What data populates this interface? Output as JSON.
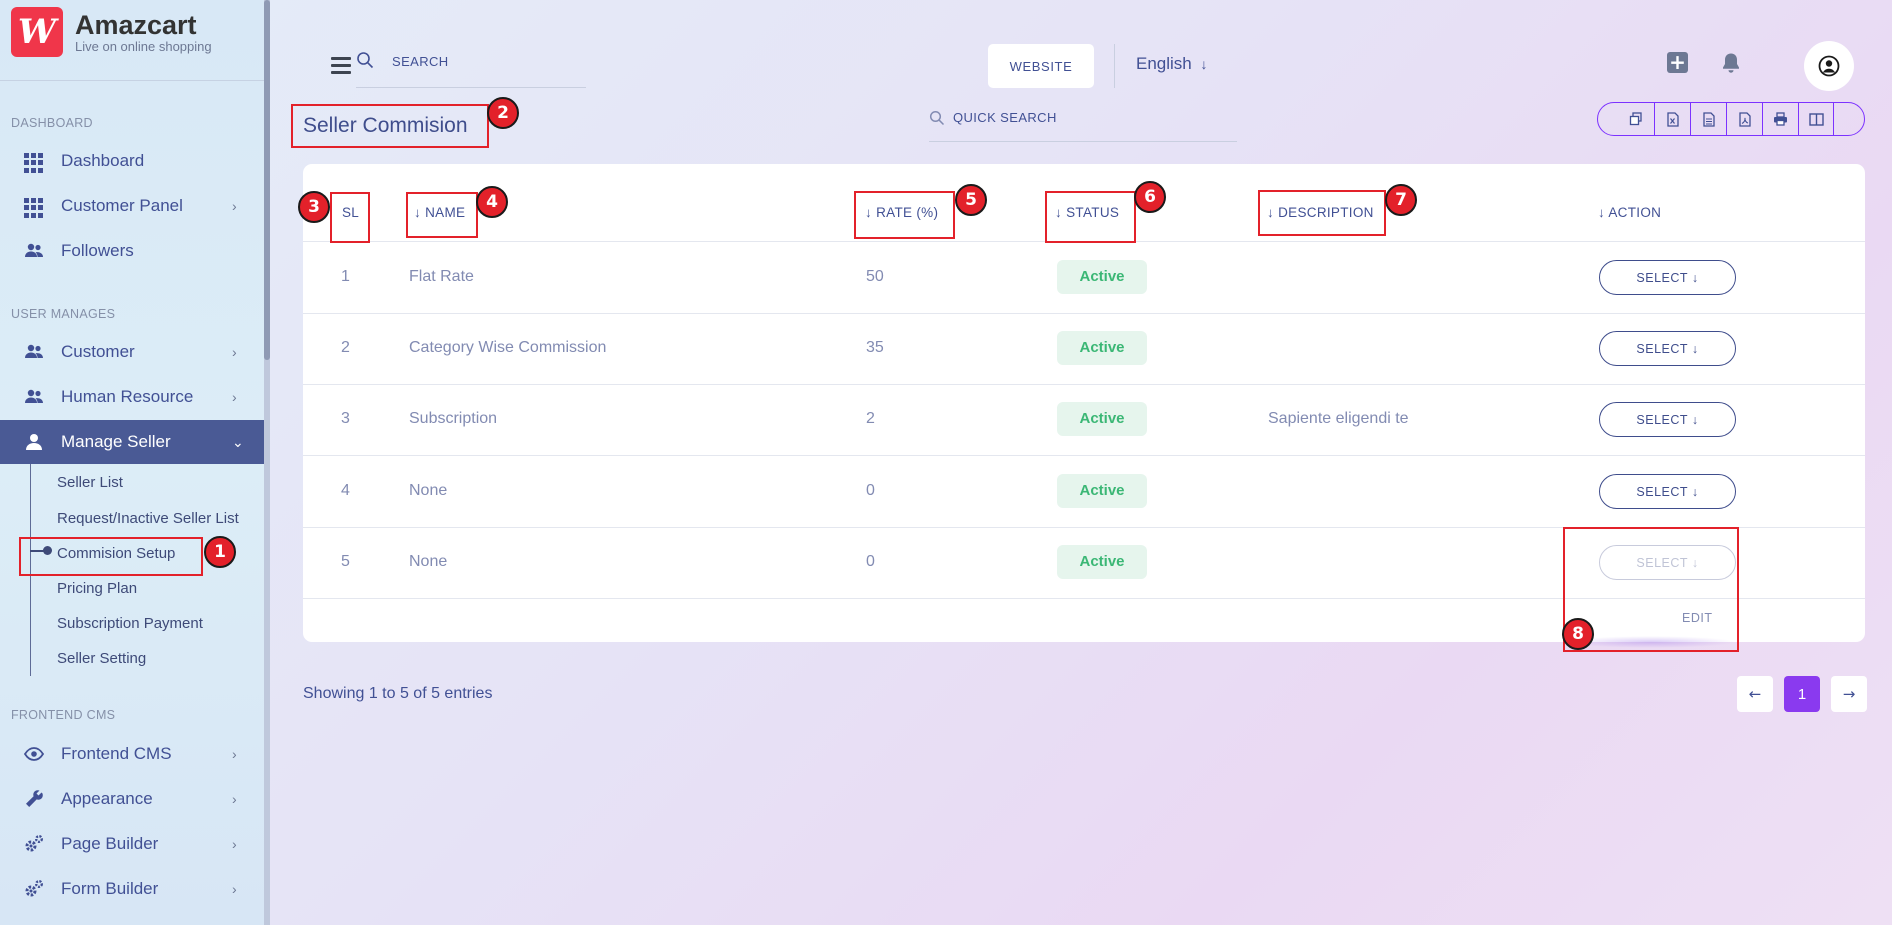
{
  "brand": {
    "logo_glyph": "W",
    "name": "Amazcart",
    "tagline": "Live on online shopping",
    "color": "#f0364a"
  },
  "sidebar": {
    "sections": {
      "dashboard": "DASHBOARD",
      "user_manages": "USER MANAGES",
      "frontend_cms": "FRONTEND CMS"
    },
    "items": [
      {
        "label": "Dashboard",
        "icon": "grid-icon",
        "chevron": ""
      },
      {
        "label": "Customer Panel",
        "icon": "grid-icon",
        "chevron": "›"
      },
      {
        "label": "Followers",
        "icon": "users-icon",
        "chevron": ""
      },
      {
        "label": "Customer",
        "icon": "users-icon",
        "chevron": "›"
      },
      {
        "label": "Human Resource",
        "icon": "users-icon",
        "chevron": "›"
      },
      {
        "label": "Manage Seller",
        "icon": "user-icon",
        "chevron": "⌄"
      },
      {
        "label": "Frontend CMS",
        "icon": "eye-icon",
        "chevron": "›"
      },
      {
        "label": "Appearance",
        "icon": "wrench-icon",
        "chevron": "›"
      },
      {
        "label": "Page Builder",
        "icon": "gears-icon",
        "chevron": "›"
      },
      {
        "label": "Form Builder",
        "icon": "gears-icon",
        "chevron": "›"
      }
    ],
    "subitems": [
      "Seller List",
      "Request/Inactive Seller List",
      "Commision Setup",
      "Pricing Plan",
      "Subscription Payment",
      "Seller Setting"
    ],
    "active_color": "#4a5a95"
  },
  "header": {
    "search_placeholder": "SEARCH",
    "website_label": "WEBSITE",
    "language": "English",
    "language_arrow": "↓"
  },
  "page": {
    "title": "Seller Commision",
    "quick_search_placeholder": "QUICK SEARCH"
  },
  "table": {
    "columns": {
      "sl": "SL",
      "name": "NAME",
      "rate": "RATE (%)",
      "status": "STATUS",
      "description": "DESCRIPTION",
      "action": "ACTION"
    },
    "sort_arrow": "↓",
    "rows": [
      {
        "sl": "1",
        "name": "Flat Rate",
        "rate": "50",
        "status": "Active",
        "description": "",
        "action": "SELECT"
      },
      {
        "sl": "2",
        "name": "Category Wise Commission",
        "rate": "35",
        "status": "Active",
        "description": "",
        "action": "SELECT"
      },
      {
        "sl": "3",
        "name": "Subscription",
        "rate": "2",
        "status": "Active",
        "description": "Sapiente eligendi te",
        "action": "SELECT"
      },
      {
        "sl": "4",
        "name": "None",
        "rate": "0",
        "status": "Active",
        "description": "",
        "action": "SELECT"
      },
      {
        "sl": "5",
        "name": "None",
        "rate": "0",
        "status": "Active",
        "description": "",
        "action": "SELECT"
      }
    ],
    "dropdown_edit": "EDIT",
    "badge_color": "#3bb775"
  },
  "footer": {
    "info": "Showing 1 to 5 of 5 entries",
    "prev": "←",
    "current_page": "1",
    "next": "→",
    "accent": "#8a3aef"
  },
  "annotations": [
    "1",
    "2",
    "3",
    "4",
    "5",
    "6",
    "7",
    "8"
  ]
}
